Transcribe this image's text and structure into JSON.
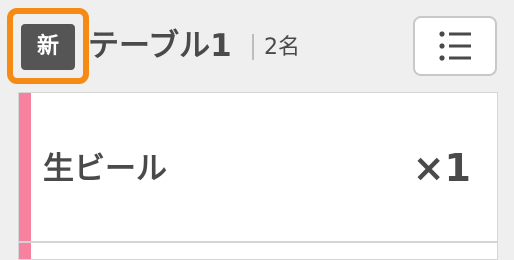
{
  "header": {
    "new_badge_label": "新",
    "table_name": "テーブル1",
    "guest_count": "2名",
    "menu_icon": "list-icon"
  },
  "order_items": [
    {
      "name": "生ビール",
      "quantity": "×1"
    }
  ],
  "colors": {
    "highlight_border": "#f58b14",
    "item_accent": "#f7829f",
    "badge_bg": "#555555"
  }
}
